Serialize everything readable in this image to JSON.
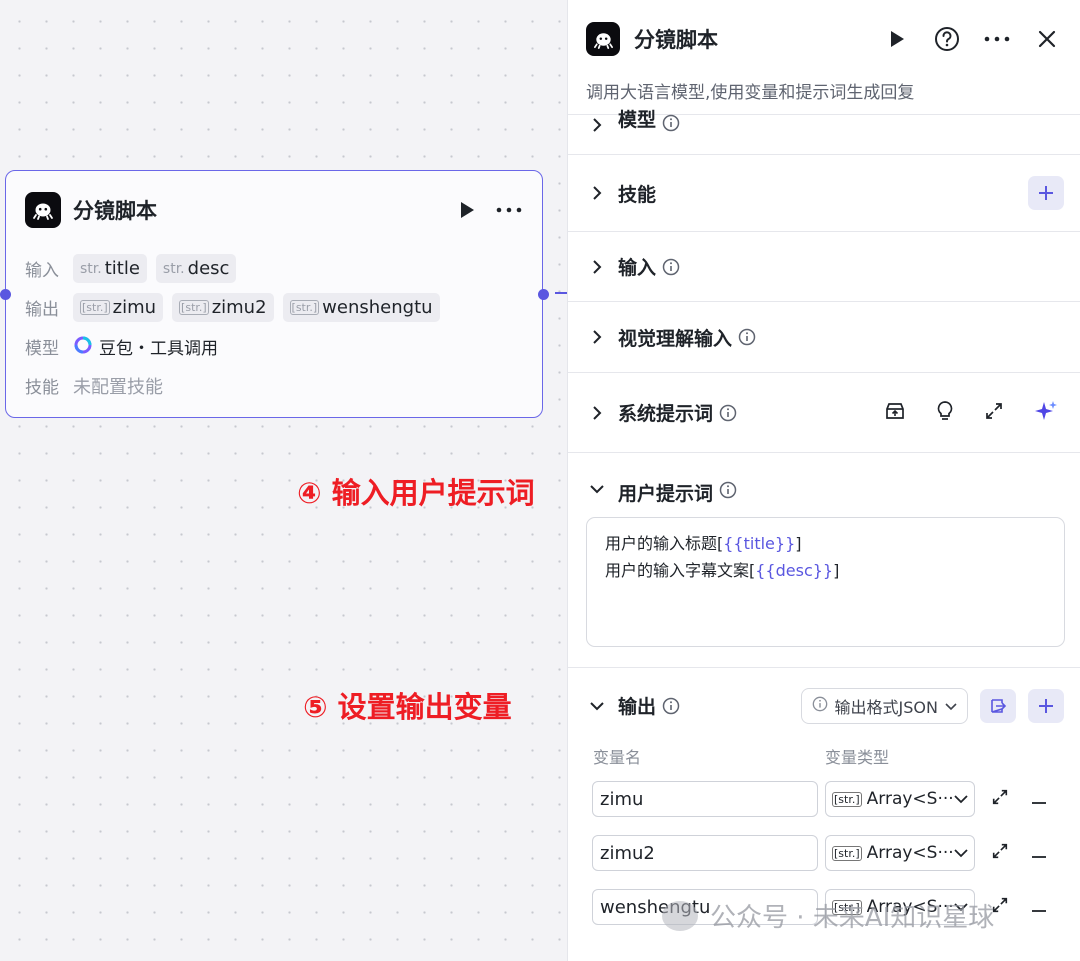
{
  "node": {
    "title": "分镜脚本",
    "rows": {
      "input_label": "输入",
      "inputs": [
        {
          "type": "str.",
          "name": "title"
        },
        {
          "type": "str.",
          "name": "desc"
        }
      ],
      "output_label": "输出",
      "outputs": [
        {
          "type": "[str.]",
          "name": "zimu"
        },
        {
          "type": "[str.]",
          "name": "zimu2"
        },
        {
          "type": "[str.]",
          "name": "wenshengtu"
        }
      ],
      "model_label": "模型",
      "model_value": "豆包・工具调用",
      "skill_label": "技能",
      "skill_value": "未配置技能"
    }
  },
  "annotations": {
    "step4": "④ 输入用户提示词",
    "step5": "⑤ 设置输出变量"
  },
  "panel": {
    "title": "分镜脚本",
    "description": "调用大语言模型,使用变量和提示词生成回复",
    "sections": {
      "model": "模型",
      "skills": "技能",
      "input": "输入",
      "vision_input": "视觉理解输入",
      "system_prompt": "系统提示词",
      "user_prompt": "用户提示词",
      "output": "输出"
    },
    "user_prompt": {
      "line1_prefix": "用户的输入标题[",
      "line1_var": "{{title}}",
      "line1_suffix": "]",
      "line2_prefix": "用户的输入字幕文案[",
      "line2_var": "{{desc}}",
      "line2_suffix": "]"
    },
    "output": {
      "format_label": "输出格式JSON",
      "col_name": "变量名",
      "col_type": "变量类型",
      "rows": [
        {
          "name": "zimu",
          "type_badge": "[str.]",
          "type": "Array<S···"
        },
        {
          "name": "zimu2",
          "type_badge": "[str.]",
          "type": "Array<S···"
        },
        {
          "name": "wenshengtu",
          "type_badge": "[str.]",
          "type": "Array<S···"
        }
      ]
    }
  },
  "watermark": "公众号 · 未来AI知识星球",
  "colors": {
    "accent": "#5a57e0",
    "annotation": "#ee1d24",
    "canvas": "#f3f3f6"
  }
}
